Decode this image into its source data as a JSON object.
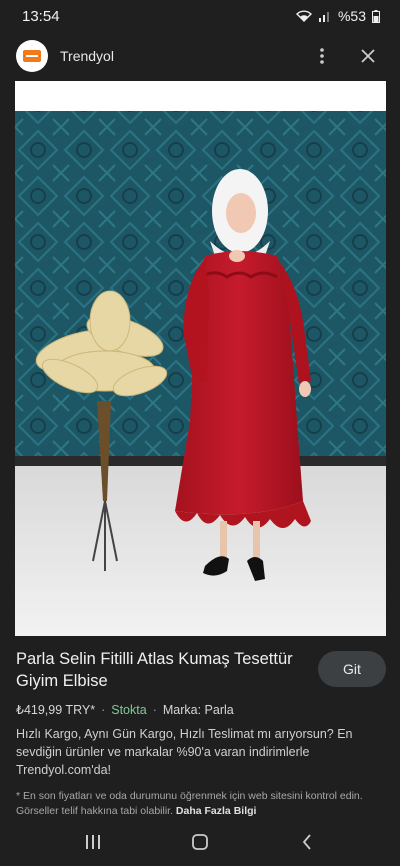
{
  "status_bar": {
    "time": "13:54",
    "battery": "%53"
  },
  "header": {
    "site_name": "Trendyol",
    "logo_icon": "trendyol-logo-icon"
  },
  "product": {
    "title": "Parla Selin Fitilli Atlas Kumaş Tesettür Giyim Elbise",
    "go_button": "Git",
    "price": "₺419,99 TRY*",
    "stock": "Stokta",
    "brand": "Marka: Parla",
    "description": "Hızlı Kargo, Aynı Gün Kargo, Hızlı Teslimat mı arıyorsun? En sevdiğin ürünler ve markalar %90'a varan indirimlerle Trendyol.com'da!",
    "disclaimer": "* En son fiyatları ve oda durumunu öğrenmek için web sitesini kontrol edin. Görseller telif hakkına tabi olabilir.",
    "more_link": "Daha Fazla Bilgi"
  },
  "colors": {
    "accent": "#f27a1a",
    "dress": "#c0182c",
    "wall": "#1e5a68",
    "stock_green": "#81c995"
  }
}
